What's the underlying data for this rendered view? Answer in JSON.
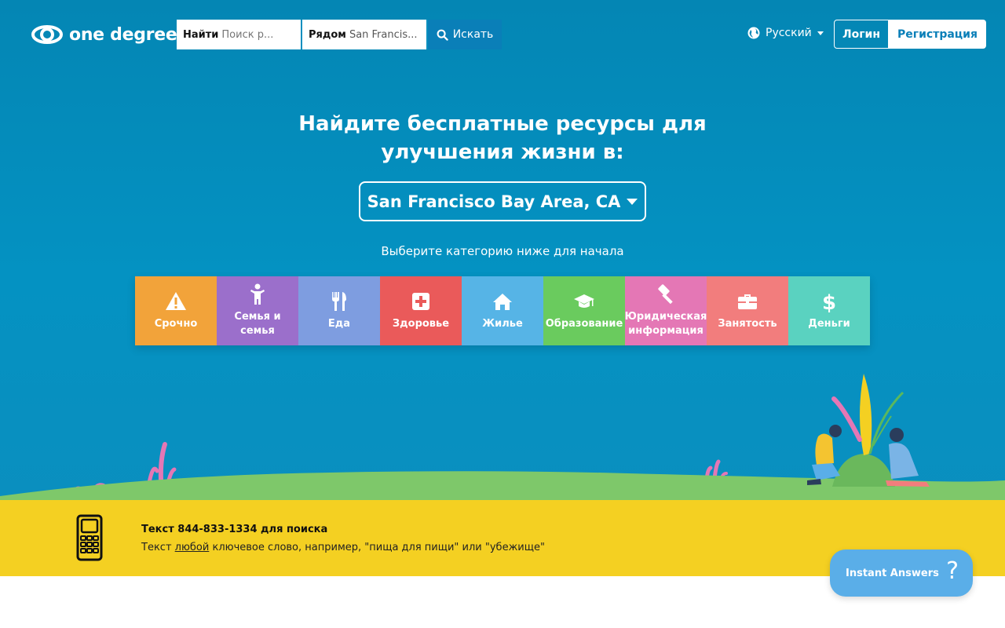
{
  "header": {
    "logo_text": "one degree",
    "search": {
      "find_label": "Найти",
      "find_placeholder": "Поиск р...",
      "near_label": "Рядом",
      "near_value": "San Francis...",
      "button_label": "Искать"
    },
    "language": "Русский",
    "login_label": "Логин",
    "register_label": "Регистрация"
  },
  "hero": {
    "headline_line1": "Найдите бесплатные ресурсы для",
    "headline_line2": "улучшения жизни в:",
    "location": "San Francisco Bay Area, CA",
    "subtitle": "Выберите категорию ниже для начала"
  },
  "categories": [
    {
      "label": "Срочно",
      "icon": "warning-icon",
      "color": "#f2a33a"
    },
    {
      "label": "Семья и семья",
      "icon": "child-icon",
      "color": "#9b6fcb"
    },
    {
      "label": "Еда",
      "icon": "utensils-icon",
      "color": "#7e9de0"
    },
    {
      "label": "Здоровье",
      "icon": "medical-icon",
      "color": "#ea5a5a"
    },
    {
      "label": "Жилье",
      "icon": "home-icon",
      "color": "#56b4e6"
    },
    {
      "label": "Образование",
      "icon": "graduation-cap-icon",
      "color": "#6acb5e"
    },
    {
      "label": "Юридическая информация",
      "icon": "gavel-icon",
      "color": "#e477b5"
    },
    {
      "label": "Занятость",
      "icon": "briefcase-icon",
      "color": "#f27d7d"
    },
    {
      "label": "Деньги",
      "icon": "dollar-icon",
      "color": "#5ad2c0"
    }
  ],
  "sms": {
    "title": "Текст 844-833-1334 для поиска",
    "desc_prefix": "Текст ",
    "desc_link": "любой",
    "desc_suffix": " ключевое слово, например, \"пища для пищи\" или \"убежище\""
  },
  "instant_answers": {
    "label": "Instant Answers",
    "icon_glyph": "?"
  },
  "colors": {
    "hero_blue": "#0492c2",
    "ground_green": "#7ec86a",
    "band_yellow": "#f4d022",
    "accent_blue": "#0a7fb8"
  }
}
